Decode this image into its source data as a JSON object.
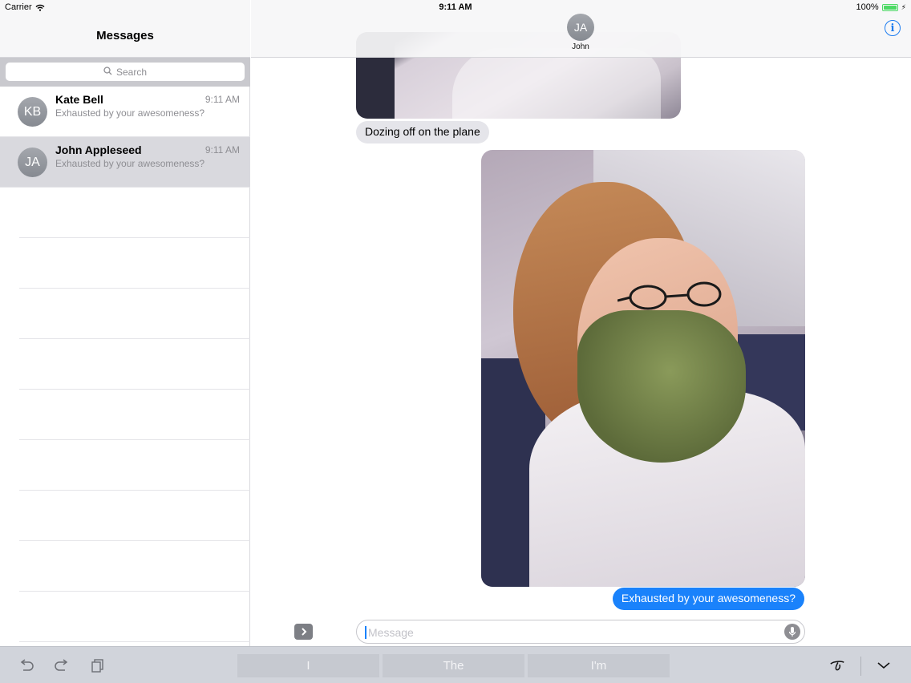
{
  "status_bar": {
    "carrier": "Carrier",
    "time": "9:11 AM",
    "battery": "100%",
    "icons": [
      "wifi-icon",
      "battery-icon",
      "charging-icon"
    ]
  },
  "sidebar": {
    "title": "Messages",
    "search_placeholder": "Search",
    "conversations": [
      {
        "initials": "KB",
        "name": "Kate Bell",
        "time": "9:11 AM",
        "preview": "Exhausted by your awesomeness?",
        "selected": false
      },
      {
        "initials": "JA",
        "name": "John Appleseed",
        "time": "9:11 AM",
        "preview": "Exhausted by your awesomeness?",
        "selected": true
      }
    ]
  },
  "conversation": {
    "contact_initials": "JA",
    "contact_name": "John",
    "info_icon": "info-icon",
    "messages": [
      {
        "type": "image",
        "direction": "incoming",
        "description_icon": "photo-icon"
      },
      {
        "type": "text",
        "direction": "incoming",
        "text": "Dozing off on the plane"
      },
      {
        "type": "image",
        "direction": "outgoing",
        "description_icon": "photo-icon"
      },
      {
        "type": "text",
        "direction": "outgoing",
        "text": "Exhausted by your awesomeness?"
      }
    ],
    "input_placeholder": "Message"
  },
  "keyboard_bar": {
    "left_icons": [
      "undo-icon",
      "redo-icon",
      "paste-icon"
    ],
    "suggestions": [
      "I",
      "The",
      "I'm"
    ],
    "right_icons": [
      "handwriting-icon",
      "hide-keyboard-icon"
    ]
  },
  "colors": {
    "accent": "#1a82fb",
    "incoming_bubble": "#e5e5ea",
    "selected_row": "#d9d9de",
    "battery": "#4cd964"
  }
}
